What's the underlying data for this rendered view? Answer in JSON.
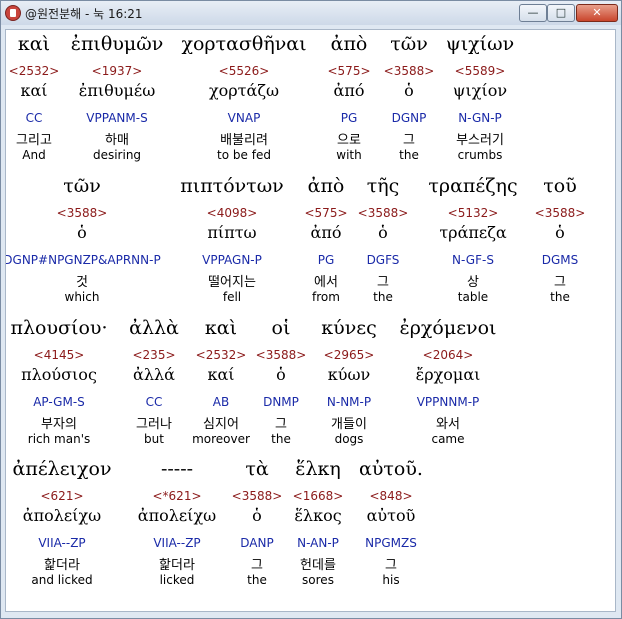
{
  "window": {
    "title": "@원전분해 - 눅 16:21",
    "controls": {
      "minimize": "—",
      "maximize": "□",
      "close": "✕"
    },
    "app_icon": "book-icon"
  },
  "lines": [
    {
      "y": 0,
      "words": [
        {
          "greek": "καὶ",
          "strongs": "<2532>",
          "lemma": "καί",
          "morph": "CC",
          "korean": "그리고",
          "english": "And"
        },
        {
          "greek": "ἐπιθυμῶν",
          "strongs": "<1937>",
          "lemma": "ἐπιθυμέω",
          "morph": "VPPANM-S",
          "korean": "하매",
          "english": "desiring"
        },
        {
          "greek": "χορτασθῆναι",
          "strongs": "<5526>",
          "lemma": "χορτάζω",
          "morph": "VNAP",
          "korean": "배불리려",
          "english": "to be fed"
        },
        {
          "greek": "ἀπὸ",
          "strongs": "<575>",
          "lemma": "ἀπό",
          "morph": "PG",
          "korean": "으로",
          "english": "with"
        },
        {
          "greek": "τῶν",
          "strongs": "<3588>",
          "lemma": "ὁ",
          "morph": "DGNP",
          "korean": "그",
          "english": "the"
        },
        {
          "greek": "ψιχίων",
          "strongs": "<5589>",
          "lemma": "ψιχίον",
          "morph": "N-GN-P",
          "korean": "부스러기",
          "english": "crumbs"
        }
      ]
    },
    {
      "y": 1,
      "words": [
        {
          "greek": "τῶν",
          "strongs": "<3588>",
          "lemma": "ὁ",
          "morph": "DGNP#NPGNZP&APRNN-P",
          "korean": "것",
          "english": "which"
        },
        {
          "greek": "πιπτόντων",
          "strongs": "<4098>",
          "lemma": "πίπτω",
          "morph": "VPPAGN-P",
          "korean": "떨어지는",
          "english": "fell"
        },
        {
          "greek": "ἀπὸ",
          "strongs": "<575>",
          "lemma": "ἀπό",
          "morph": "PG",
          "korean": "에서",
          "english": "from"
        },
        {
          "greek": "τῆς",
          "strongs": "<3588>",
          "lemma": "ὁ",
          "morph": "DGFS",
          "korean": "그",
          "english": "the"
        },
        {
          "greek": "τραπέζης",
          "strongs": "<5132>",
          "lemma": "τράπεζα",
          "morph": "N-GF-S",
          "korean": "상",
          "english": "table"
        },
        {
          "greek": "τοῦ",
          "strongs": "<3588>",
          "lemma": "ὁ",
          "morph": "DGMS",
          "korean": "그",
          "english": "the"
        }
      ]
    },
    {
      "y": 2,
      "words": [
        {
          "greek": "πλουσίου·",
          "strongs": "<4145>",
          "lemma": "πλούσιος",
          "morph": "AP-GM-S",
          "korean": "부자의",
          "english": "rich man's"
        },
        {
          "greek": "ἀλλὰ",
          "strongs": "<235>",
          "lemma": "ἀλλά",
          "morph": "CC",
          "korean": "그러나",
          "english": "but"
        },
        {
          "greek": "καὶ",
          "strongs": "<2532>",
          "lemma": "καί",
          "morph": "AB",
          "korean": "심지어",
          "english": "moreover"
        },
        {
          "greek": "οἱ",
          "strongs": "<3588>",
          "lemma": "ὁ",
          "morph": "DNMP",
          "korean": "그",
          "english": "the"
        },
        {
          "greek": "κύνες",
          "strongs": "<2965>",
          "lemma": "κύων",
          "morph": "N-NM-P",
          "korean": "개들이",
          "english": "dogs"
        },
        {
          "greek": "ἐρχόμενοι",
          "strongs": "<2064>",
          "lemma": "ἔρχομαι",
          "morph": "VPPNNM-P",
          "korean": "와서",
          "english": "came"
        }
      ]
    },
    {
      "y": 3,
      "words": [
        {
          "greek": "ἀπέλειχον",
          "strongs": "<621>",
          "lemma": "ἀπολείχω",
          "morph": "VIIA--ZP",
          "korean": "핥더라",
          "english": "and licked"
        },
        {
          "greek": "-----",
          "strongs": "<*621>",
          "lemma": "ἀπολείχω",
          "morph": "VIIA--ZP",
          "korean": "핥더라",
          "english": "licked"
        },
        {
          "greek": "τὰ",
          "strongs": "<3588>",
          "lemma": "ὁ",
          "morph": "DANP",
          "korean": "그",
          "english": "the"
        },
        {
          "greek": "ἕλκη",
          "strongs": "<1668>",
          "lemma": "ἕλκος",
          "morph": "N-AN-P",
          "korean": "헌데를",
          "english": "sores"
        },
        {
          "greek": "αὐτοῦ.",
          "strongs": "<848>",
          "lemma": "αὐτοῦ",
          "morph": "NPGMZS",
          "korean": "그",
          "english": "his"
        }
      ]
    }
  ],
  "colors": {
    "strongs": "#8b1a1a",
    "morph": "#1a2aa8",
    "titlebar": "#cdd9e8",
    "close_button": "#c9452c"
  }
}
